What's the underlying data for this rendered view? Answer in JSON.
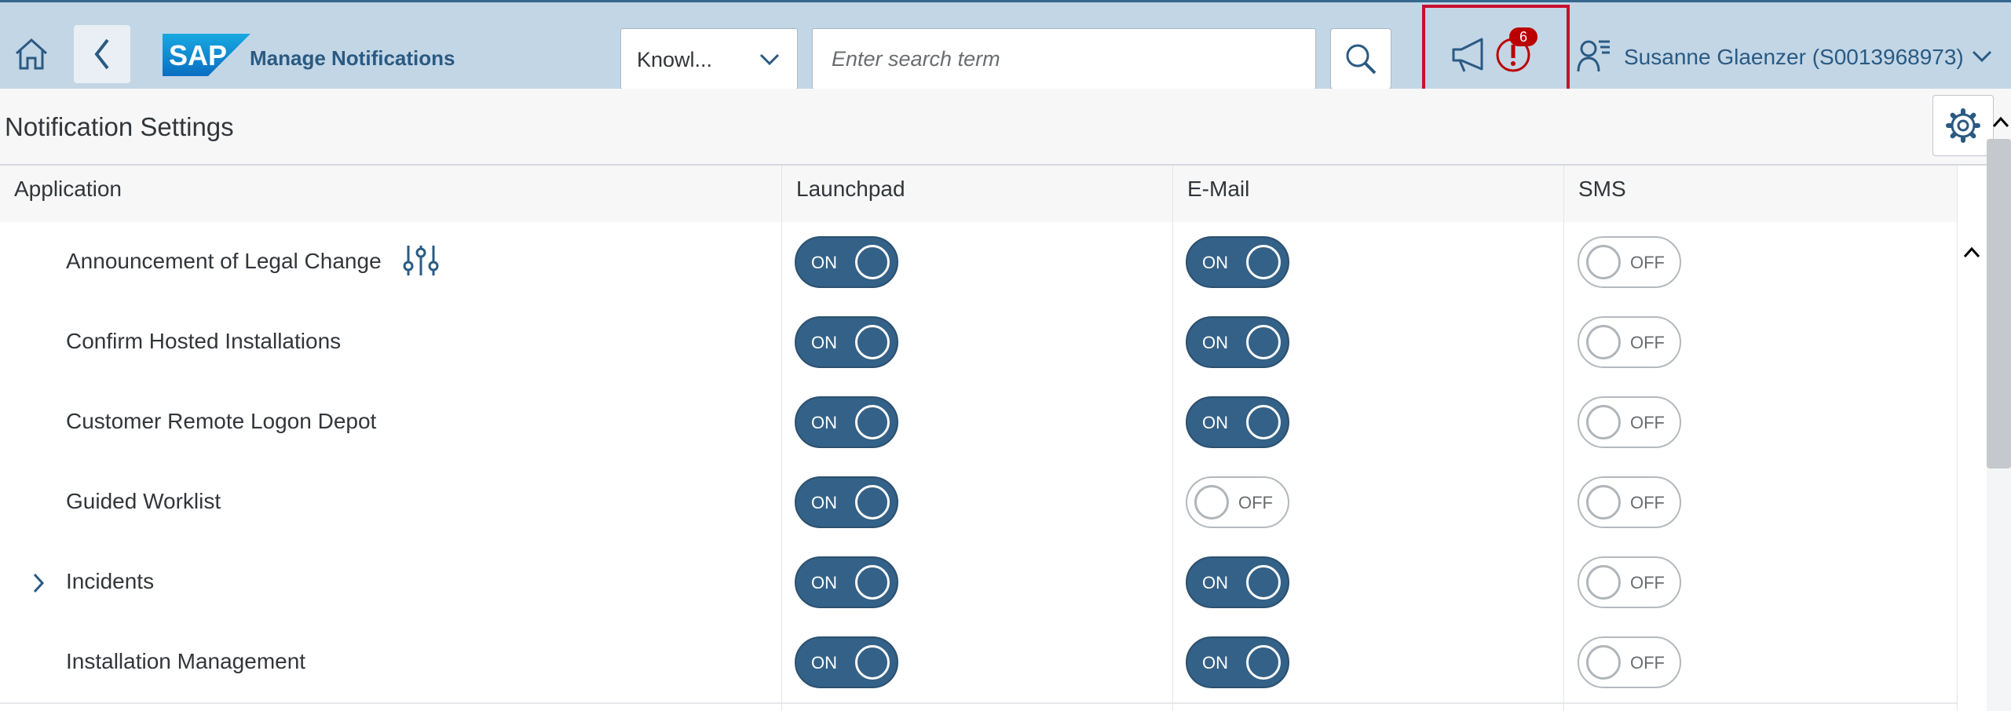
{
  "shell": {
    "app_title": "Manage Notifications",
    "scope_value": "Knowl...",
    "search_placeholder": "Enter search term",
    "notification_count": "6",
    "user_name": "Susanne Glaenzer (S0013968973)",
    "logo_text": "SAP"
  },
  "page": {
    "title": "Notification Settings"
  },
  "table": {
    "columns": [
      "Application",
      "Launchpad",
      "E-Mail",
      "SMS"
    ],
    "rows": [
      {
        "name": "Announcement of Legal Change",
        "launchpad": "ON",
        "email": "ON",
        "sms": "OFF"
      },
      {
        "name": "Confirm Hosted Installations",
        "launchpad": "ON",
        "email": "ON",
        "sms": "OFF"
      },
      {
        "name": "Customer Remote Logon Depot",
        "launchpad": "ON",
        "email": "ON",
        "sms": "OFF"
      },
      {
        "name": "Guided Worklist",
        "launchpad": "ON",
        "email": "OFF",
        "sms": "OFF"
      },
      {
        "name": "Incidents",
        "launchpad": "ON",
        "email": "ON",
        "sms": "OFF"
      },
      {
        "name": "Installation Management",
        "launchpad": "ON",
        "email": "ON",
        "sms": "OFF"
      }
    ]
  },
  "colors": {
    "shell_bg": "#c3d6e6",
    "accent": "#346187",
    "highlight": "#c8102e",
    "badge": "#bb0000"
  }
}
